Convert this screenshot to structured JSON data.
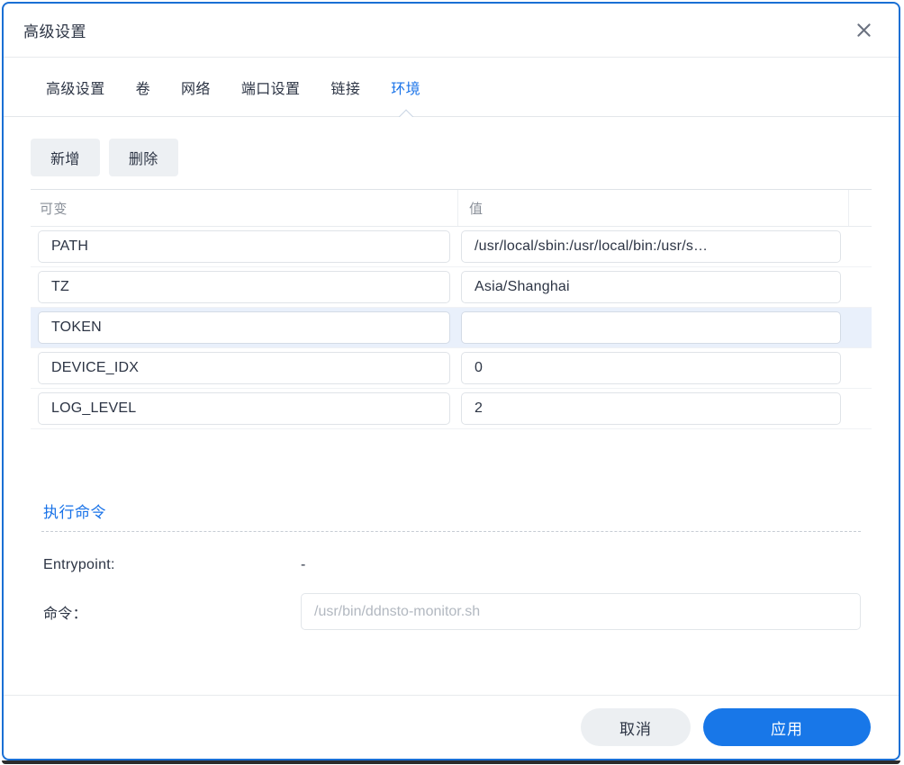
{
  "dialog": {
    "title": "高级设置",
    "close_icon": "close-icon",
    "accent_color": "#1a73e8",
    "border_color": "#1a6fd4"
  },
  "tabs": [
    {
      "label": "高级设置",
      "active": false
    },
    {
      "label": "卷",
      "active": false
    },
    {
      "label": "网络",
      "active": false
    },
    {
      "label": "端口设置",
      "active": false
    },
    {
      "label": "链接",
      "active": false
    },
    {
      "label": "环境",
      "active": true
    }
  ],
  "toolbar": {
    "add_label": "新增",
    "delete_label": "删除"
  },
  "table": {
    "headers": [
      "可变",
      "值",
      ""
    ],
    "rows": [
      {
        "variable": "PATH",
        "value": "/usr/local/sbin:/usr/local/bin:/usr/s…",
        "selected": false
      },
      {
        "variable": "TZ",
        "value": "Asia/Shanghai",
        "selected": false
      },
      {
        "variable": "TOKEN",
        "value": "",
        "selected": true
      },
      {
        "variable": "DEVICE_IDX",
        "value": "0",
        "selected": false
      },
      {
        "variable": "LOG_LEVEL",
        "value": "2",
        "selected": false
      }
    ]
  },
  "command": {
    "section_title": "执行命令",
    "entrypoint_label": "Entrypoint:",
    "entrypoint_value": "-",
    "command_label": "命令：",
    "command_value": "",
    "command_placeholder": "/usr/bin/ddnsto-monitor.sh"
  },
  "footer": {
    "cancel_label": "取消",
    "apply_label": "应用"
  }
}
